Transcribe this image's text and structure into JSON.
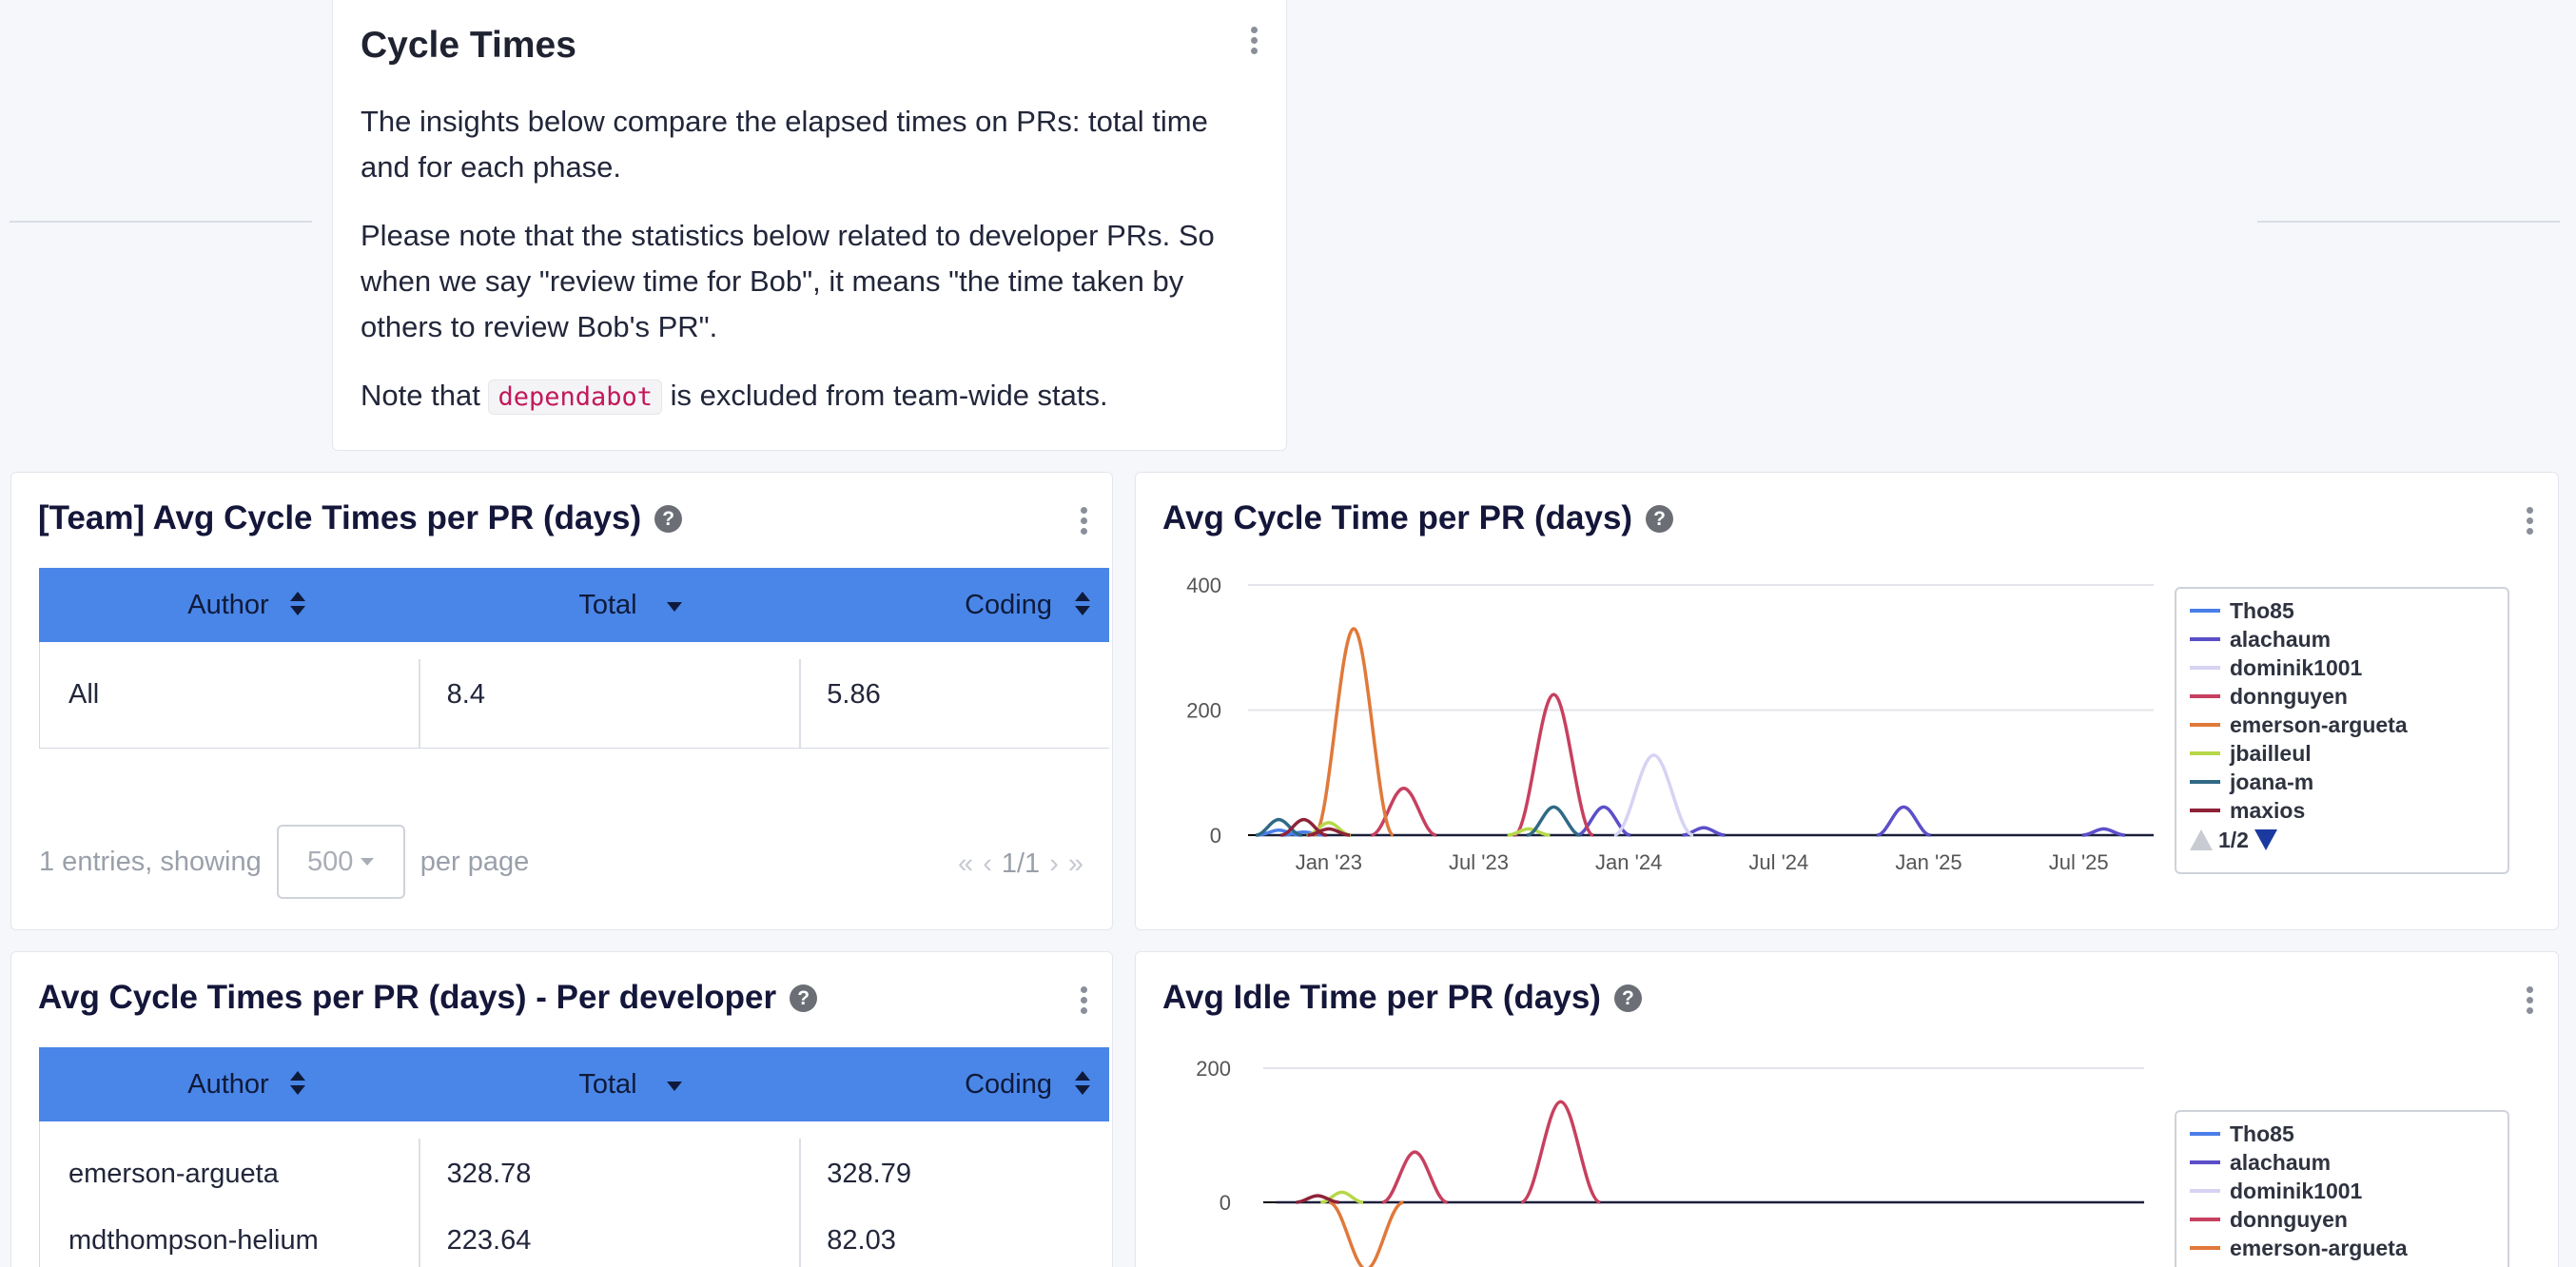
{
  "intro": {
    "title": "Cycle Times",
    "p1": "The insights below compare the elapsed times on PRs: total time and for each phase.",
    "p2": "Please note that the statistics below related to developer PRs. So when we say \"review time for Bob\", it means \"the time taken by others to review Bob's PR\".",
    "p3_before": "Note that",
    "p3_code": "dependabot",
    "p3_after": "is excluded from team-wide stats."
  },
  "team_table": {
    "title": "[Team] Avg Cycle Times per PR (days)",
    "columns": [
      "Author",
      "Total",
      "Coding"
    ],
    "rows": [
      [
        "All",
        "8.4",
        "5.86"
      ]
    ],
    "entries_text": "1 entries, showing",
    "per_page_value": "500",
    "per_page_text": "per page",
    "page_indicator": "1/1"
  },
  "dev_table": {
    "title": "Avg Cycle Times per PR (days) - Per developer",
    "columns": [
      "Author",
      "Total",
      "Coding"
    ],
    "rows": [
      [
        "emerson-argueta",
        "328.78",
        "328.79"
      ],
      [
        "mdthompson-helium",
        "223.64",
        "82.03"
      ]
    ]
  },
  "legend_series": [
    {
      "name": "Tho85",
      "color": "#4a7ee8"
    },
    {
      "name": "alachaum",
      "color": "#5b4fc9"
    },
    {
      "name": "dominik1001",
      "color": "#d6d3f3"
    },
    {
      "name": "donnguyen",
      "color": "#c7405f"
    },
    {
      "name": "emerson-argueta",
      "color": "#e0793a"
    },
    {
      "name": "jbailleul",
      "color": "#b7d84a"
    },
    {
      "name": "joana-m",
      "color": "#2f6a86"
    },
    {
      "name": "maxios",
      "color": "#8e2238"
    }
  ],
  "legend_page": "1/2",
  "chart_data": [
    {
      "type": "line",
      "title": "Avg Cycle Time per PR (days)",
      "ylim": [
        0,
        400
      ],
      "yticks": [
        "0",
        "200",
        "400"
      ],
      "xticks": [
        "Jan '23",
        "Jul '23",
        "Jan '24",
        "Jul '24",
        "Jan '25",
        "Jul '25"
      ],
      "legend": "right",
      "series": [
        {
          "name": "Tho85",
          "x": [
            "Nov '22",
            "Dec '22"
          ],
          "y": [
            8,
            5
          ]
        },
        {
          "name": "alachaum",
          "x": [
            "Dec '23",
            "Apr '24",
            "Dec '24",
            "Aug '25"
          ],
          "y": [
            45,
            12,
            45,
            10
          ]
        },
        {
          "name": "dominik1001",
          "x": [
            "Feb '24"
          ],
          "y": [
            128
          ]
        },
        {
          "name": "donnguyen",
          "x": [
            "Apr '23",
            "Oct '23"
          ],
          "y": [
            75,
            225
          ]
        },
        {
          "name": "emerson-argueta",
          "x": [
            "Feb '23"
          ],
          "y": [
            330
          ]
        },
        {
          "name": "jbailleul",
          "x": [
            "Jan '23",
            "Sep '23"
          ],
          "y": [
            20,
            10
          ]
        },
        {
          "name": "joana-m",
          "x": [
            "Nov '22",
            "Oct '23"
          ],
          "y": [
            25,
            45
          ]
        },
        {
          "name": "maxios",
          "x": [
            "Dec '22",
            "Jan '23"
          ],
          "y": [
            25,
            10
          ]
        }
      ]
    },
    {
      "type": "line",
      "title": "Avg Idle Time per PR (days)",
      "ylim": [
        -100,
        200
      ],
      "yticks": [
        "0",
        "200"
      ],
      "legend": "right",
      "series": [
        {
          "name": "donnguyen",
          "x": [
            "Apr '23",
            "Oct '23"
          ],
          "y": [
            75,
            150
          ]
        },
        {
          "name": "emerson-argueta",
          "x": [
            "Feb '23"
          ],
          "y": [
            -100
          ]
        },
        {
          "name": "jbailleul",
          "x": [
            "Jan '23"
          ],
          "y": [
            15
          ]
        },
        {
          "name": "maxios",
          "x": [
            "Dec '22"
          ],
          "y": [
            10
          ]
        }
      ]
    }
  ]
}
